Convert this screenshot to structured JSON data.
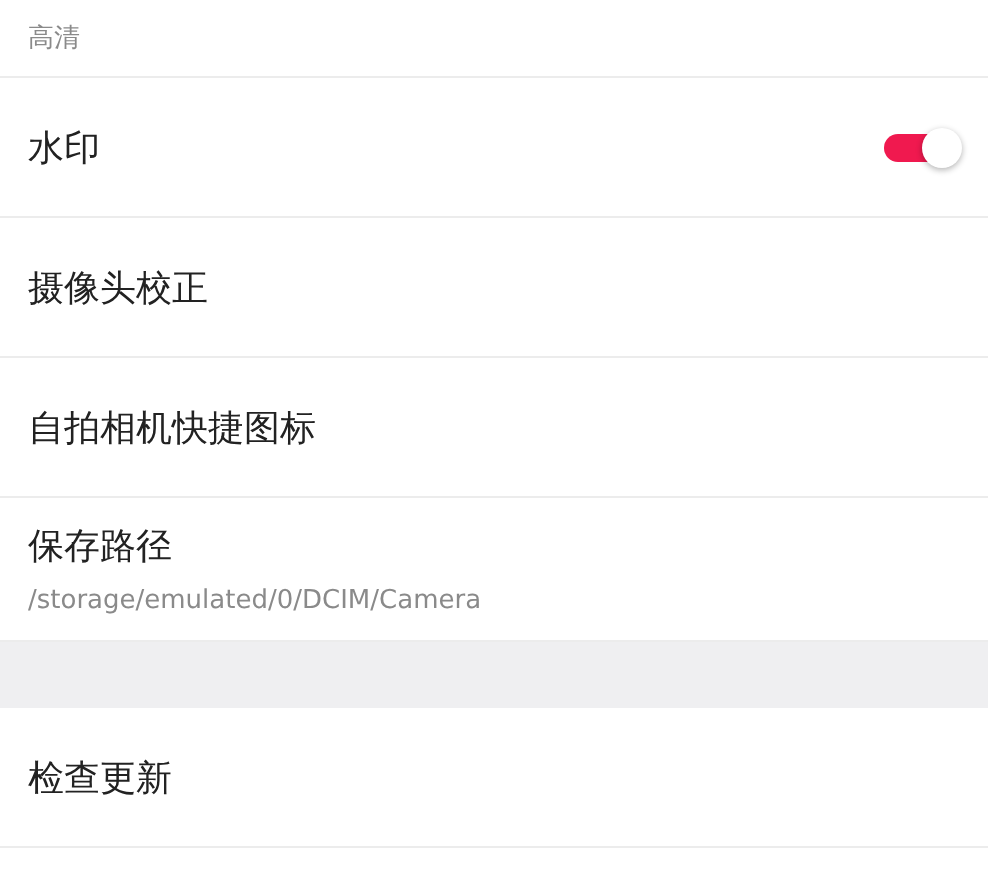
{
  "groups": [
    {
      "items": [
        {
          "kind": "value",
          "subtitle": "高清"
        },
        {
          "kind": "toggle",
          "title": "水印",
          "on": true
        },
        {
          "kind": "plain",
          "title": "摄像头校正"
        },
        {
          "kind": "plain",
          "title": "自拍相机快捷图标"
        },
        {
          "kind": "value",
          "title": "保存路径",
          "subtitle": "/storage/emulated/0/DCIM/Camera"
        }
      ]
    },
    {
      "items": [
        {
          "kind": "plain",
          "title": "检查更新"
        }
      ]
    }
  ]
}
